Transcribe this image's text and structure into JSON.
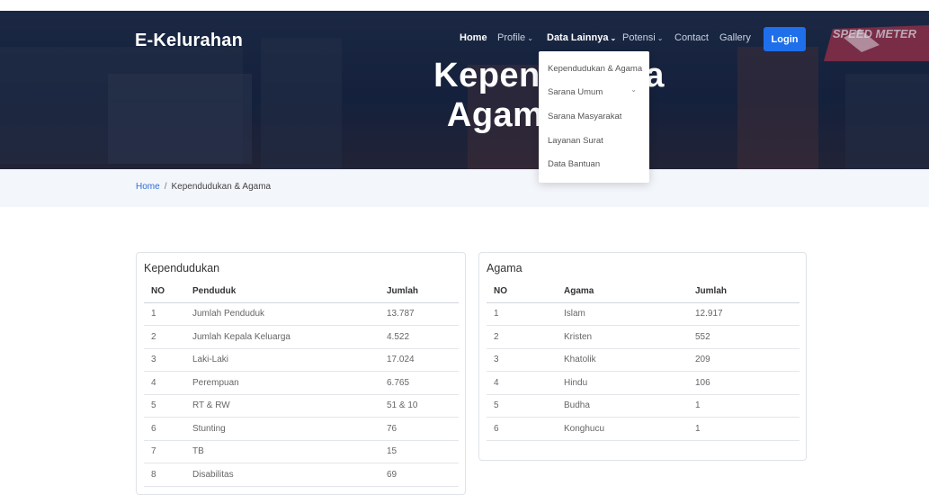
{
  "header": {
    "brand": "E-Kelurahan",
    "nav": [
      {
        "label": "Home"
      },
      {
        "label": "Profile"
      },
      {
        "label": "Data Lainnya"
      },
      {
        "label": "Potensi"
      },
      {
        "label": "Contact"
      },
      {
        "label": "Gallery"
      }
    ],
    "login_label": "Login",
    "title_line1": "Kependuduka",
    "title_line2": "Agama",
    "banner_text": "SPEED METER"
  },
  "dropdown": {
    "items": [
      {
        "label": "Kependudukan & Agama"
      },
      {
        "label": "Sarana Umum"
      },
      {
        "label": "Sarana Masyarakat"
      },
      {
        "label": "Layanan Surat"
      },
      {
        "label": "Data Bantuan"
      }
    ]
  },
  "breadcrumb": {
    "home": "Home",
    "separator": "/",
    "current": "Kependudukan & Agama"
  },
  "kependudukan": {
    "title": "Kependudukan",
    "headers": {
      "no": "NO",
      "name": "Penduduk",
      "value": "Jumlah"
    },
    "rows": [
      {
        "no": "1",
        "name": "Jumlah Penduduk",
        "value": "13.787"
      },
      {
        "no": "2",
        "name": "Jumlah Kepala Keluarga",
        "value": "4.522"
      },
      {
        "no": "3",
        "name": "Laki-Laki",
        "value": "17.024"
      },
      {
        "no": "4",
        "name": "Perempuan",
        "value": "6.765"
      },
      {
        "no": "5",
        "name": "RT & RW",
        "value": "51 & 10"
      },
      {
        "no": "6",
        "name": "Stunting",
        "value": "76"
      },
      {
        "no": "7",
        "name": "TB",
        "value": "15"
      },
      {
        "no": "8",
        "name": "Disabilitas",
        "value": "69"
      }
    ]
  },
  "agama": {
    "title": "Agama",
    "headers": {
      "no": "NO",
      "name": "Agama",
      "value": "Jumlah"
    },
    "rows": [
      {
        "no": "1",
        "name": "Islam",
        "value": "12.917"
      },
      {
        "no": "2",
        "name": "Kristen",
        "value": "552"
      },
      {
        "no": "3",
        "name": "Khatolik",
        "value": "209"
      },
      {
        "no": "4",
        "name": "Hindu",
        "value": "106"
      },
      {
        "no": "5",
        "name": "Budha",
        "value": "1"
      },
      {
        "no": "6",
        "name": "Konghucu",
        "value": "1"
      }
    ]
  }
}
